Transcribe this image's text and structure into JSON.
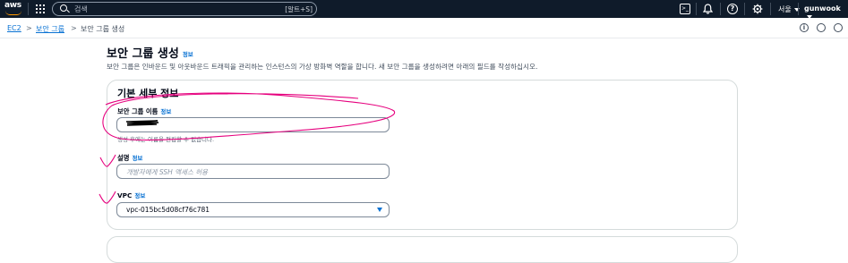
{
  "topbar": {
    "logo_text": "aws",
    "search_placeholder": "검색",
    "search_shortcut": "[알트+S]",
    "icons": [
      "cloudshell-icon",
      "bell-icon",
      "help-icon",
      "settings-icon"
    ],
    "region_label": "서울",
    "user_label": "gunwook"
  },
  "breadcrumb": {
    "items": [
      "EC2",
      "보안 그룹",
      "보안 그룹 생성"
    ],
    "separator": ">"
  },
  "page": {
    "title": "보안 그룹 생성",
    "title_info": "정보",
    "description": "보안 그룹은 인바운드 및 아웃바운드 트래픽을 관리하는 인스턴스의 가상 방화벽 역할을 합니다. 새 보안 그룹을 생성하려면 아래의 필드를 작성하십시오."
  },
  "panel": {
    "title": "기본 세부 정보",
    "name_field": {
      "label": "보안 그룹 이름",
      "info": "정보",
      "hint": "생성 후에는 이름을 편집할 수 없습니다."
    },
    "description_field": {
      "label": "설명",
      "info": "정보",
      "value": "개발자에게 SSH 액세스 허용"
    },
    "vpc_field": {
      "label": "VPC",
      "info": "정보",
      "value": "vpc-015bc5d08cf76c781"
    }
  },
  "colors": {
    "topbar_bg": "#0f1b2a",
    "link": "#0972d3",
    "annotation": "#e6007e"
  }
}
